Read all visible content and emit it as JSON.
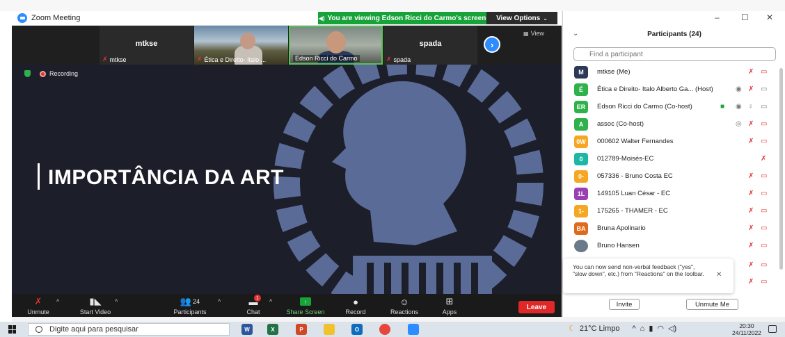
{
  "zoom_window": {
    "title": "Zoom Meeting",
    "share_banner": "You are viewing Edson Ricci do Carmo's screen",
    "view_options": "View Options",
    "view_button": "View"
  },
  "video_strip": {
    "tiles": [
      {
        "name": "mtkse",
        "label": "mtkse"
      },
      {
        "name": "",
        "label": "Ética e Direito- Italo ..."
      },
      {
        "name": "",
        "label": "Edson Ricci do Carmo"
      },
      {
        "name": "spada",
        "label": "spada"
      }
    ]
  },
  "share": {
    "recording": "Recording",
    "slide_title": "IMPORTÂNCIA DA ART"
  },
  "toolbar": {
    "unmute": "Unmute",
    "start_video": "Start Video",
    "participants": "Participants",
    "participants_count": "24",
    "chat": "Chat",
    "chat_badge": "1",
    "share_screen": "Share Screen",
    "record": "Record",
    "reactions": "Reactions",
    "apps": "Apps",
    "leave": "Leave"
  },
  "participants_panel": {
    "header": "Participants (24)",
    "search_placeholder": "Find a participant",
    "rows": [
      {
        "initials": "M",
        "color": "#2c3a57",
        "name": "mtkse (Me)"
      },
      {
        "initials": "É",
        "color": "#2fb24c",
        "name": "Ética e Direito- Italo Alberto Ga... (Host)"
      },
      {
        "initials": "ER",
        "color": "#2fb24c",
        "name": "Edson Ricci do Carmo (Co-host)"
      },
      {
        "initials": "A",
        "color": "#2fb24c",
        "name": "assoc (Co-host)"
      },
      {
        "initials": "0W",
        "color": "#f5a623",
        "name": "000602 Walter Fernandes"
      },
      {
        "initials": "0",
        "color": "#1db7a6",
        "name": "012789-Moisés-EC"
      },
      {
        "initials": "0-",
        "color": "#f5a623",
        "name": "057336 - Bruno Costa EC"
      },
      {
        "initials": "1L",
        "color": "#9b3fb5",
        "name": "149105 Luan César - EC"
      },
      {
        "initials": "1-",
        "color": "#f5a623",
        "name": "175265 - THAMER - EC"
      },
      {
        "initials": "BA",
        "color": "#e06a1c",
        "name": "Bruna Apolinario"
      },
      {
        "initials": "",
        "color": "#6b7a8a",
        "name": "Bruno Hansen"
      }
    ],
    "tooltip": "You can now send non-verbal feedback (\"yes\", \"slow down\", etc.) from \"Reactions\" on the toolbar.",
    "invite": "Invite",
    "unmute_me": "Unmute Me"
  },
  "taskbar": {
    "search_placeholder": "Digite aqui para pesquisar",
    "weather": "21°C  Limpo",
    "time": "20:30",
    "date": "24/11/2022"
  },
  "colors": {
    "zoom_blue": "#2d8cff",
    "share_green": "#18a33a",
    "leave_red": "#e02828",
    "slide_bg": "#1c1f2a",
    "watermark": "#5a6b98"
  }
}
